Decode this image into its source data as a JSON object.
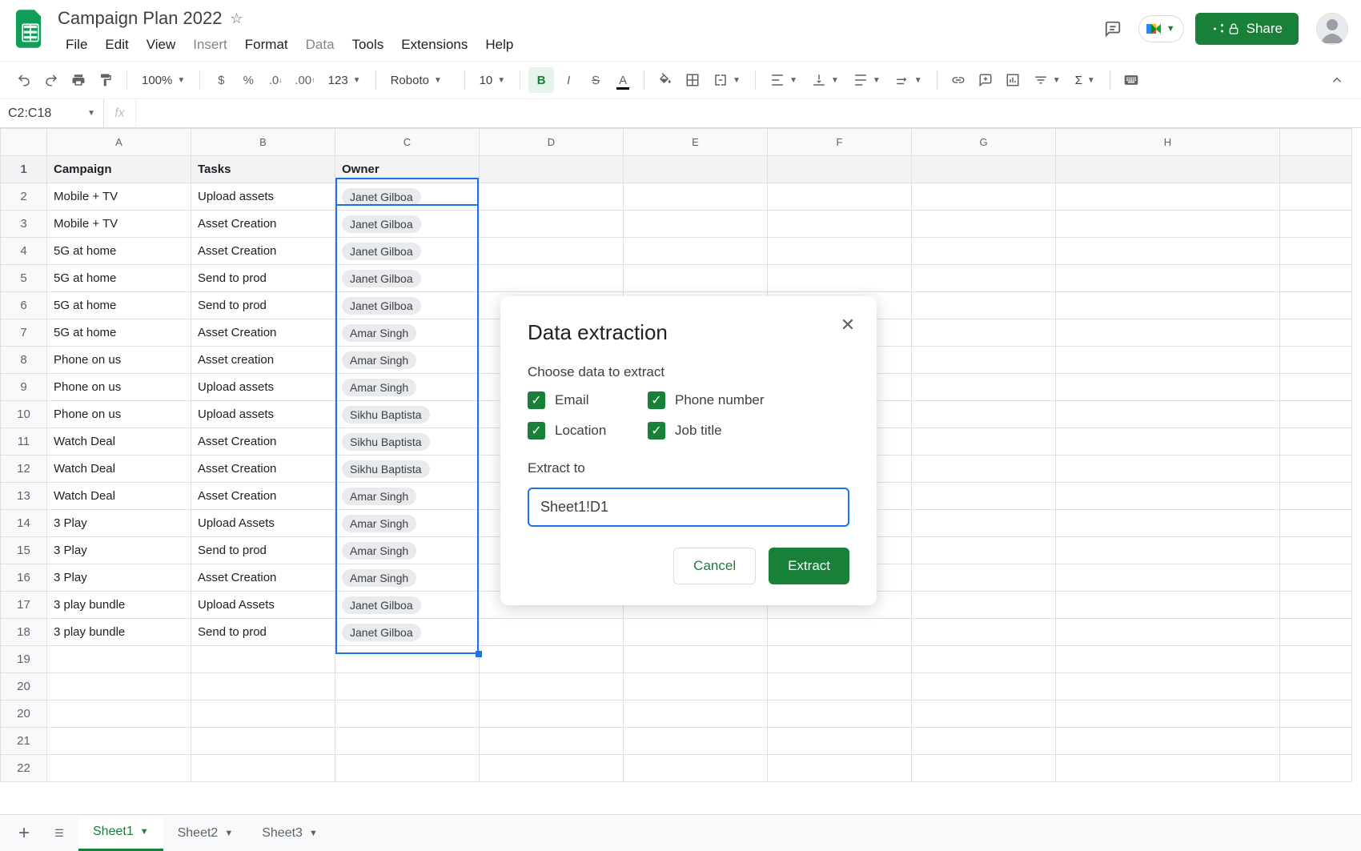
{
  "doc": {
    "title": "Campaign Plan 2022"
  },
  "menu": {
    "items": [
      "File",
      "Edit",
      "View",
      "Insert",
      "Format",
      "Data",
      "Tools",
      "Extensions",
      "Help"
    ],
    "muted": [
      "Insert",
      "Data"
    ]
  },
  "share": {
    "label": "Share"
  },
  "toolbar": {
    "zoom": "100%",
    "font": "Roboto",
    "font_size": "10",
    "format_number": "123"
  },
  "namebox": {
    "ref": "C2:C18",
    "fx": "fx"
  },
  "columns": [
    "A",
    "B",
    "C",
    "D",
    "E",
    "F",
    "G",
    "H",
    ""
  ],
  "headers": {
    "campaign": "Campaign",
    "tasks": "Tasks",
    "owner": "Owner"
  },
  "rows": [
    {
      "n": 1,
      "campaign": "Campaign",
      "tasks": "Tasks",
      "owner_header": "Owner"
    },
    {
      "n": 2,
      "campaign": "Mobile + TV",
      "tasks": "Upload assets",
      "owner": "Janet Gilboa"
    },
    {
      "n": 3,
      "campaign": "Mobile + TV",
      "tasks": "Asset Creation",
      "owner": "Janet Gilboa"
    },
    {
      "n": 4,
      "campaign": "5G at home",
      "tasks": "Asset Creation",
      "owner": "Janet Gilboa"
    },
    {
      "n": 5,
      "campaign": "5G at home",
      "tasks": "Send to prod",
      "owner": "Janet Gilboa"
    },
    {
      "n": 6,
      "campaign": "5G at home",
      "tasks": "Send to prod",
      "owner": "Janet Gilboa"
    },
    {
      "n": 7,
      "campaign": "5G at home",
      "tasks": "Asset Creation",
      "owner": "Amar Singh"
    },
    {
      "n": 8,
      "campaign": "Phone on us",
      "tasks": "Asset creation",
      "owner": "Amar Singh"
    },
    {
      "n": 9,
      "campaign": "Phone on us",
      "tasks": "Upload assets",
      "owner": "Amar Singh"
    },
    {
      "n": 10,
      "campaign": "Phone on us",
      "tasks": "Upload assets",
      "owner": "Sikhu Baptista"
    },
    {
      "n": 11,
      "campaign": "Watch Deal",
      "tasks": "Asset Creation",
      "owner": "Sikhu Baptista"
    },
    {
      "n": 12,
      "campaign": "Watch Deal",
      "tasks": "Asset Creation",
      "owner": "Sikhu Baptista"
    },
    {
      "n": 13,
      "campaign": "Watch Deal",
      "tasks": "Asset Creation",
      "owner": "Amar Singh"
    },
    {
      "n": 14,
      "campaign": "3 Play",
      "tasks": "Upload Assets",
      "owner": "Amar Singh"
    },
    {
      "n": 15,
      "campaign": "3 Play",
      "tasks": "Send to prod",
      "owner": "Amar Singh"
    },
    {
      "n": 16,
      "campaign": "3 Play",
      "tasks": "Asset Creation",
      "owner": "Amar Singh"
    },
    {
      "n": 17,
      "campaign": "3 play bundle",
      "tasks": "Upload Assets",
      "owner": "Janet Gilboa"
    },
    {
      "n": 18,
      "campaign": "3 play bundle",
      "tasks": "Send to prod",
      "owner": "Janet Gilboa"
    },
    {
      "n": 19
    },
    {
      "n": 20
    },
    {
      "n": 20
    },
    {
      "n": 21
    },
    {
      "n": 22
    }
  ],
  "dialog": {
    "title": "Data extraction",
    "choose_label": "Choose data to extract",
    "checks": [
      {
        "label": "Email",
        "checked": true
      },
      {
        "label": "Phone number",
        "checked": true
      },
      {
        "label": "Location",
        "checked": true
      },
      {
        "label": "Job title",
        "checked": true
      }
    ],
    "extract_to_label": "Extract to",
    "extract_to_value": "Sheet1!D1",
    "cancel": "Cancel",
    "extract": "Extract"
  },
  "sheets": {
    "tabs": [
      "Sheet1",
      "Sheet2",
      "Sheet3"
    ],
    "active": "Sheet1"
  }
}
